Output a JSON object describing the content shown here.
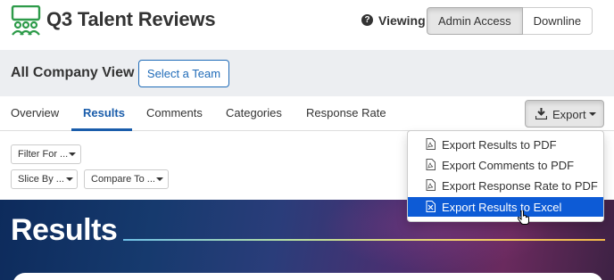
{
  "header": {
    "title": "Q3 Talent Reviews",
    "viewing_label": "Viewing",
    "view_options": [
      "Admin Access",
      "Downline"
    ]
  },
  "company": {
    "label": "All Company View",
    "select_team": "Select a Team"
  },
  "tabs": [
    "Overview",
    "Results",
    "Comments",
    "Categories",
    "Response Rate"
  ],
  "export": {
    "label": "Export",
    "menu": [
      "Export Results to PDF",
      "Export Comments to PDF",
      "Export Response Rate to PDF",
      "Export Results to Excel"
    ]
  },
  "filters": {
    "filter_for": "Filter For ...",
    "slice_by": "Slice By ...",
    "compare_to": "Compare To ..."
  },
  "banner": {
    "title": "Results"
  },
  "colors": {
    "brand_green": "#2e9b4a",
    "accent_blue": "#1a5dab",
    "menu_highlight": "#0d5bd6"
  }
}
